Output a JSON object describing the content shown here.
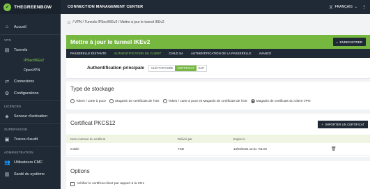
{
  "brand": {
    "name": "THEGREENBOW"
  },
  "sidebar": {
    "items": [
      {
        "label": "Accueil",
        "icon": "home-icon"
      }
    ],
    "vpn_section": "VPN",
    "tunnels": {
      "label": "Tunnels",
      "icon": "tunnel-icon"
    },
    "tunnel_subs": [
      "IPSec/IKEv2",
      "OpenVPN"
    ],
    "connexions": {
      "label": "Connexions",
      "icon": "connections-icon"
    },
    "configurations": {
      "label": "Configurations",
      "icon": "gear-icon"
    },
    "licences_section": "LICENCES",
    "serveur": {
      "label": "Serveur d'activation",
      "icon": "shield-icon"
    },
    "supervision_section": "SUPERVISION",
    "traces": {
      "label": "Traces d'audit",
      "icon": "audit-icon"
    },
    "admin_section": "ADMINISTRATION",
    "users": {
      "label": "Utilisateurs CMC",
      "icon": "users-icon"
    },
    "sante": {
      "label": "Santé du système",
      "icon": "health-icon"
    }
  },
  "topbar": {
    "title": "CONNECTION MANAGEMENT CENTER",
    "language": "FRANÇAIS",
    "lang_icon": "translate-icon"
  },
  "breadcrumb": {
    "home_icon": "home-icon",
    "text": "/  VPN  /  Tunnels IPSec/IKEv2  /  Mettre à jour le tunnel IKEv2"
  },
  "header": {
    "title": "Mettre à jour le tunnel IKEv2",
    "save_label": "ENREGISTRER"
  },
  "tabs": [
    "PASSERELLE DISTANTE",
    "AUTHENTIFICATION DU CLIENT",
    "CHILD SA",
    "AUTHENTIFICATION DE LA PASSERELLE",
    "AVANCÉ"
  ],
  "auth": {
    "label": "Authentification principale",
    "options": [
      "CLÉ PARTAGÉE",
      "CERTIFICAT",
      "EAP"
    ],
    "selected": "CERTIFICAT"
  },
  "storage": {
    "title": "Type de stockage",
    "options": [
      "Token / carte à puce",
      "Magasin de certificats de l'OS",
      "Token / carte à puce et Magasin de certificats de l'OS",
      "Magasin de certificats du Client VPN"
    ],
    "selected": "Magasin de certificats du Client VPN"
  },
  "pkcs": {
    "title": "Certificat PKCS12",
    "import_label": "IMPORTER UN CERTIFICAT",
    "columns": [
      "Nom commun du certificat",
      "Délivré par",
      "Expire le"
    ],
    "rows": [
      {
        "name": "mobile",
        "issuer": "TGB",
        "expires": "10/03/2031 12:31 +01:00"
      }
    ]
  },
  "options": {
    "title": "Options",
    "checkbox_label": "Vérifier le certificat client par rapport à la CRL"
  },
  "colors": {
    "accent": "#76b83f",
    "dark": "#1f2a36",
    "active_text": "#8fd14f"
  }
}
